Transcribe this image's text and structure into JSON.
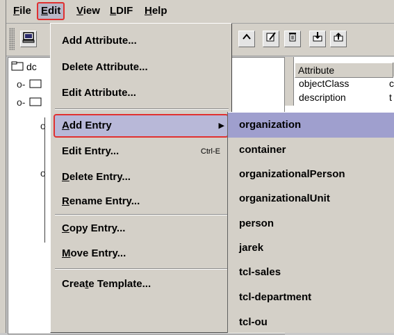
{
  "menubar": [
    {
      "pre": "",
      "mn": "F",
      "post": "ile"
    },
    {
      "pre": "",
      "mn": "E",
      "post": "dit"
    },
    {
      "pre": "",
      "mn": "V",
      "post": "iew"
    },
    {
      "pre": "",
      "mn": "L",
      "post": "DIF"
    },
    {
      "pre": "",
      "mn": "H",
      "post": "elp"
    }
  ],
  "tree": {
    "root_label": "dc"
  },
  "table": {
    "header": "Attribute",
    "rows": [
      "objectClass",
      "description"
    ],
    "row_values": [
      "c",
      "t"
    ]
  },
  "edit_menu": {
    "items": [
      {
        "pre": "Add Attribute...",
        "mn": "",
        "post": ""
      },
      {
        "pre": "Delete Attribute...",
        "mn": "",
        "post": ""
      },
      {
        "pre": "Edit Attribute...",
        "mn": "",
        "post": ""
      },
      {
        "pre": "",
        "mn": "A",
        "post": "dd Entry"
      },
      {
        "pre": "Edit Entry...",
        "mn": "",
        "post": "",
        "accel": "Ctrl-E"
      },
      {
        "pre": "",
        "mn": "D",
        "post": "elete Entry..."
      },
      {
        "pre": "",
        "mn": "R",
        "post": "ename Entry..."
      },
      {
        "pre": "",
        "mn": "C",
        "post": "opy Entry..."
      },
      {
        "pre": "",
        "mn": "M",
        "post": "ove Entry..."
      },
      {
        "pre": "Crea",
        "mn": "t",
        "post": "e Template..."
      }
    ]
  },
  "submenu": {
    "items": [
      "organization",
      "container",
      "organizationalPerson",
      "organizationalUnit",
      "person",
      "jarek",
      "tcl-sales",
      "tcl-department",
      "tcl-ou"
    ]
  },
  "colors": {
    "highlight": "#9f9fce",
    "selection_outline": "#e03030",
    "menu_bg": "#d4d0c8"
  },
  "icons": [
    "computer-icon",
    "up-icon",
    "edit-icon",
    "trash-icon",
    "export-icon",
    "import-icon",
    "folder-icon"
  ]
}
